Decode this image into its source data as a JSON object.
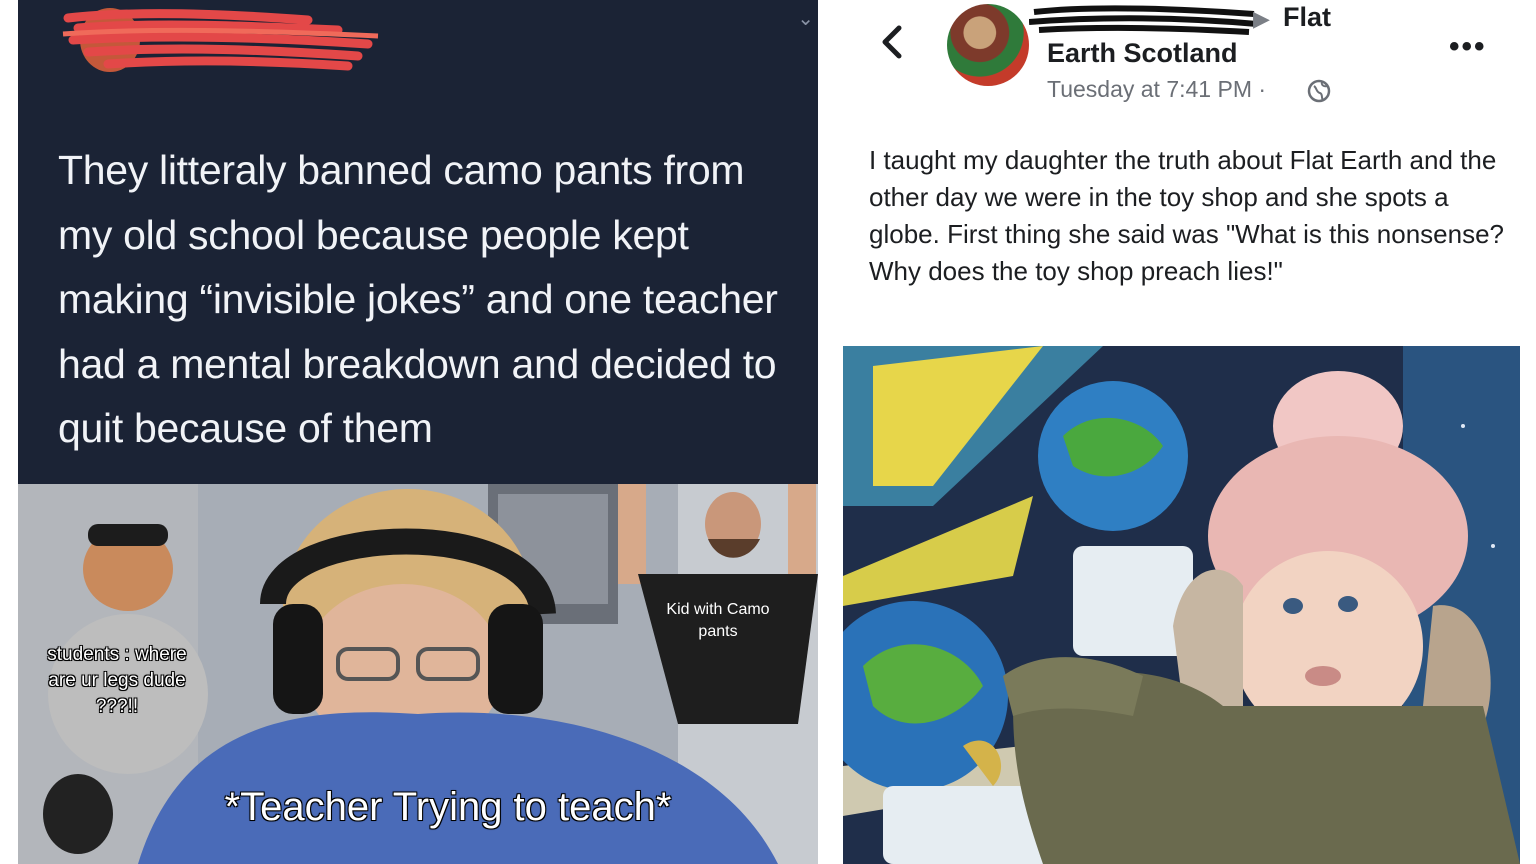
{
  "left": {
    "tweet_text": "They litteraly banned camo pants from my old school because people kept making “invisible jokes” and one teacher had a mental breakdown and decided to quit because of them",
    "meme": {
      "label_students": "students : where are ur legs dude ???!!",
      "label_kid": "Kid with Camo pants",
      "label_teacher": "*Teacher Trying to teach*"
    }
  },
  "right": {
    "author_tail": "Flat",
    "author_line2": "Earth Scotland",
    "arrow": "▶",
    "timestamp": "Tuesday at 7:41 PM ·",
    "more": "•••",
    "post_text": "I taught my daughter the truth about Flat Earth and the other day we were in the toy shop and she spots a globe. First thing she said was \"What is this nonsense? Why does the toy shop preach lies!\""
  },
  "colors": {
    "tweet_bg": "#1b2335",
    "redaction": "#e34848",
    "fb_text": "#1c1e21",
    "fb_meta": "#6b6f76"
  },
  "icons": {
    "back": "chevron-left-icon",
    "globe": "globe-icon",
    "more": "more-icon",
    "dropdown": "chevron-down-icon"
  }
}
